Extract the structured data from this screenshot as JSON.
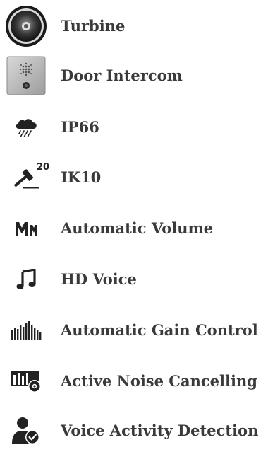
{
  "features": [
    {
      "label": "Turbine",
      "icon": "turbine-speaker-icon"
    },
    {
      "label": "Door Intercom",
      "icon": "door-intercom-icon"
    },
    {
      "label": "IP66",
      "icon": "rain-cloud-icon"
    },
    {
      "label": "IK10",
      "icon": "hammer-impact-icon",
      "icon_text": "20"
    },
    {
      "label": "Automatic Volume",
      "icon": "automatic-volume-icon"
    },
    {
      "label": "HD Voice",
      "icon": "music-note-icon"
    },
    {
      "label": "Automatic Gain Control",
      "icon": "gain-bars-icon"
    },
    {
      "label": "Active Noise Cancelling",
      "icon": "noise-cancelling-icon"
    },
    {
      "label": "Voice Activity Detection",
      "icon": "voice-activity-person-icon"
    }
  ]
}
